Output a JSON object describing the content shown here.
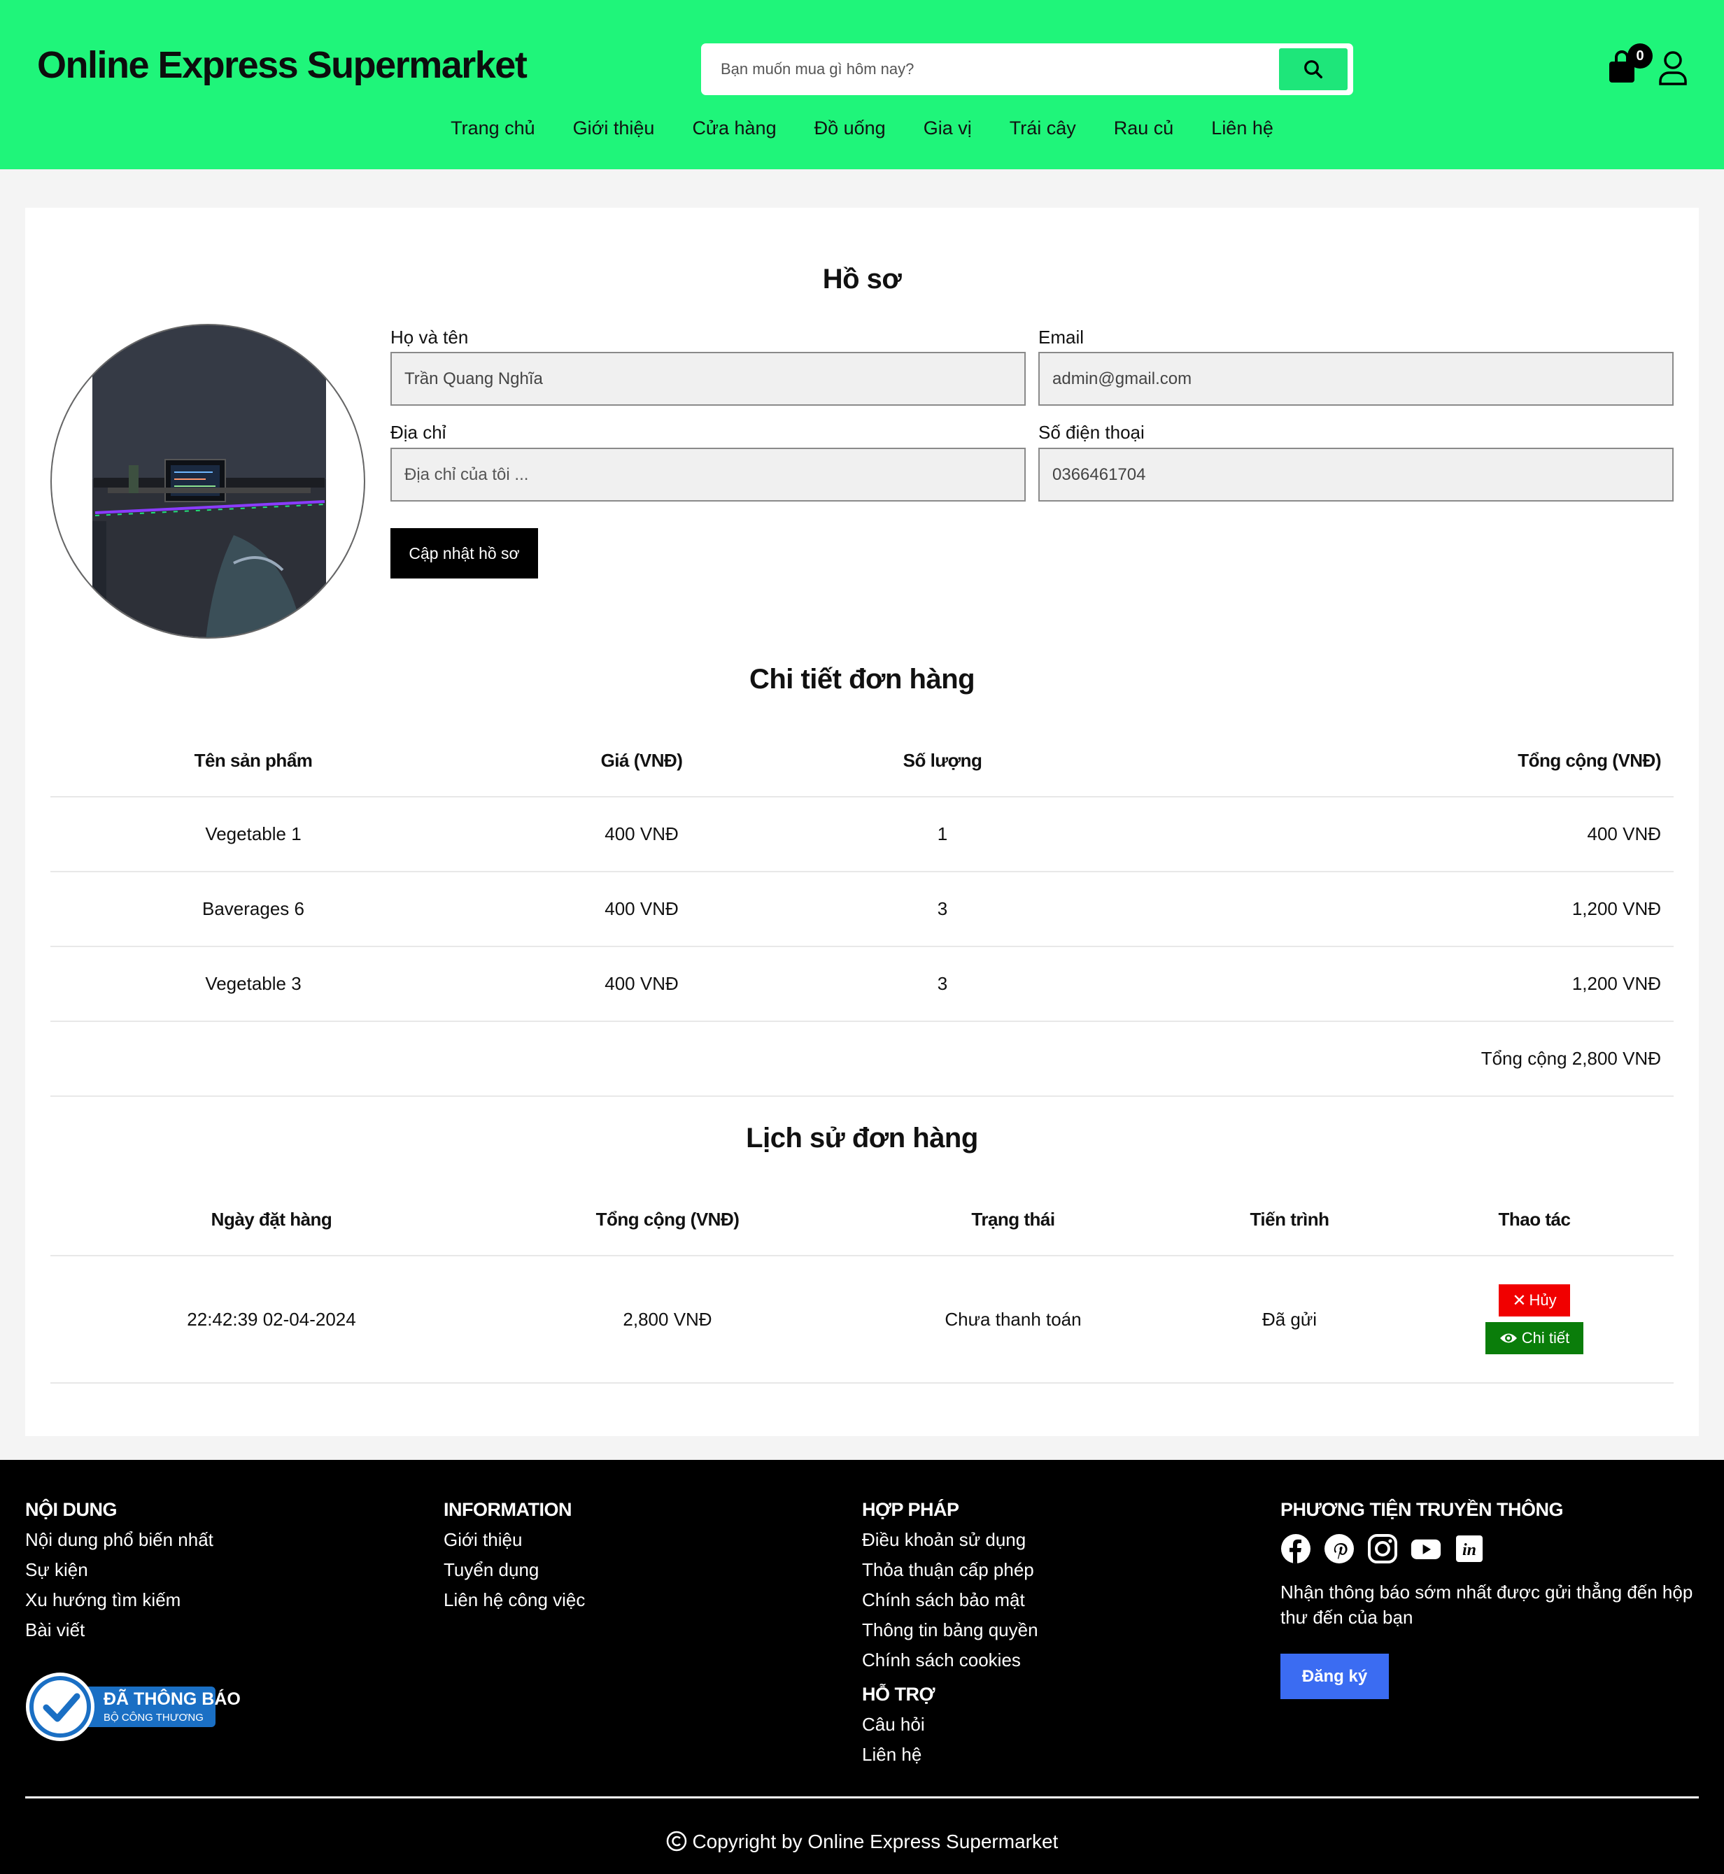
{
  "header": {
    "brand": "Online Express Supermarket",
    "search_placeholder": "Bạn muốn mua gì hôm nay?",
    "cart_count": "0",
    "nav": [
      "Trang chủ",
      "Giới thiệu",
      "Cửa hàng",
      "Đồ uống",
      "Gia vị",
      "Trái cây",
      "Rau củ",
      "Liên hệ"
    ]
  },
  "profile": {
    "title": "Hồ sơ",
    "fullname_label": "Họ và tên",
    "fullname_value": "Trần Quang Nghĩa",
    "email_label": "Email",
    "email_value": "admin@gmail.com",
    "address_label": "Địa chỉ",
    "address_placeholder": "Địa chỉ của tôi ...",
    "phone_label": "Số điện thoại",
    "phone_value": "0366461704",
    "update_button": "Cập nhật hồ sơ"
  },
  "order_detail": {
    "title": "Chi tiết đơn hàng",
    "headers": [
      "Tên sản phẩm",
      "Giá (VNĐ)",
      "Số lượng",
      "Tổng cộng (VNĐ)"
    ],
    "rows": [
      {
        "name": "Vegetable 1",
        "price": "400 VNĐ",
        "qty": "1",
        "total": "400 VNĐ"
      },
      {
        "name": "Baverages 6",
        "price": "400 VNĐ",
        "qty": "3",
        "total": "1,200 VNĐ"
      },
      {
        "name": "Vegetable 3",
        "price": "400 VNĐ",
        "qty": "3",
        "total": "1,200 VNĐ"
      }
    ],
    "grand_total": "Tổng cộng 2,800 VNĐ"
  },
  "order_history": {
    "title": "Lịch sử đơn hàng",
    "headers": [
      "Ngày đặt hàng",
      "Tổng cộng (VNĐ)",
      "Trạng thái",
      "Tiến trình",
      "Thao tác"
    ],
    "rows": [
      {
        "date": "22:42:39 02-04-2024",
        "total": "2,800 VNĐ",
        "status": "Chưa thanh toán",
        "progress": "Đã gửi",
        "cancel_label": "Hủy",
        "detail_label": "Chi tiết"
      }
    ]
  },
  "footer": {
    "col1": {
      "title": "NỘI DUNG",
      "links": [
        "Nội dung phổ biến nhất",
        "Sự kiện",
        "Xu hướng tìm kiếm",
        "Bài viết"
      ]
    },
    "badge": {
      "line1": "ĐÃ THÔNG BÁO",
      "line2": "BỘ CÔNG THƯƠNG"
    },
    "col2": {
      "title": "INFORMATION",
      "links": [
        "Giới thiệu",
        "Tuyển dụng",
        "Liên hệ công việc"
      ]
    },
    "col3": {
      "title": "HỢP PHÁP",
      "links": [
        "Điều khoản sử dụng",
        "Thỏa thuận cấp phép",
        "Chính sách bảo mật",
        "Thông tin bảng quyền",
        "Chính sách cookies"
      ]
    },
    "col3b": {
      "title": "HỖ TRỢ",
      "links": [
        "Câu hỏi",
        "Liên hệ"
      ]
    },
    "col4": {
      "title": "PHƯƠNG TIỆN TRUYỀN THÔNG",
      "social_icons": [
        "facebook-icon",
        "pinterest-icon",
        "instagram-icon",
        "youtube-icon",
        "linkedin-icon"
      ],
      "text": "Nhận thông báo sớm nhất được gửi thẳng đến hộp thư đến của bạn",
      "subscribe": "Đăng ký"
    },
    "copyright": "Copyright by Online Express Supermarket"
  },
  "colors": {
    "header_bg": "#1ff57a",
    "search_btn": "#1ee67a",
    "cancel": "#f10000",
    "detail": "#0a7d0a",
    "subscribe": "#3b6cf2"
  }
}
